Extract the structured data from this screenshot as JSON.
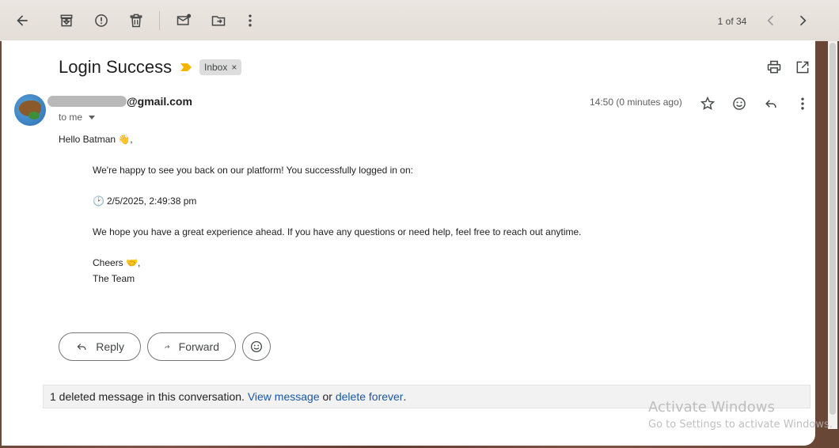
{
  "toolbar": {
    "icons": [
      "back-arrow-icon",
      "archive-icon",
      "report-spam-icon",
      "delete-icon",
      "mark-unread-icon",
      "move-to-icon",
      "more-vertical-icon"
    ],
    "pager_text": "1 of 34",
    "prev_icon": "chevron-left-icon",
    "next_icon": "chevron-right-icon"
  },
  "email": {
    "subject": "Login Success",
    "label": "Inbox",
    "label_remove": "×",
    "sender_visible": "@gmail.com",
    "recipient_text": "to me",
    "timestamp": "14:50 (0 minutes ago)",
    "body": {
      "greeting": "Hello Batman 👋,",
      "line1": "We're happy to see you back on our platform! You successfully logged in on:",
      "clock_emoji": "🕑",
      "login_time": "2/5/2025, 2:49:38 pm",
      "line3": "We hope you have a great experience ahead. If you have any questions or need help, feel free to reach out anytime.",
      "signoff": "Cheers 🤝,",
      "signature": "The Team"
    }
  },
  "actions": {
    "reply_label": "Reply",
    "forward_label": "Forward"
  },
  "deleted_notice": {
    "text": "1 deleted message in this conversation.",
    "view_link": "View message",
    "or_text": "or",
    "delete_link": "delete forever",
    "period": "."
  },
  "watermark": {
    "line1": "Activate Windows",
    "line2": "Go to Settings to activate Windows."
  },
  "colors": {
    "importance_marker": "#f4b400",
    "link": "#1a57a6",
    "label_chip_bg": "#dddddd"
  }
}
